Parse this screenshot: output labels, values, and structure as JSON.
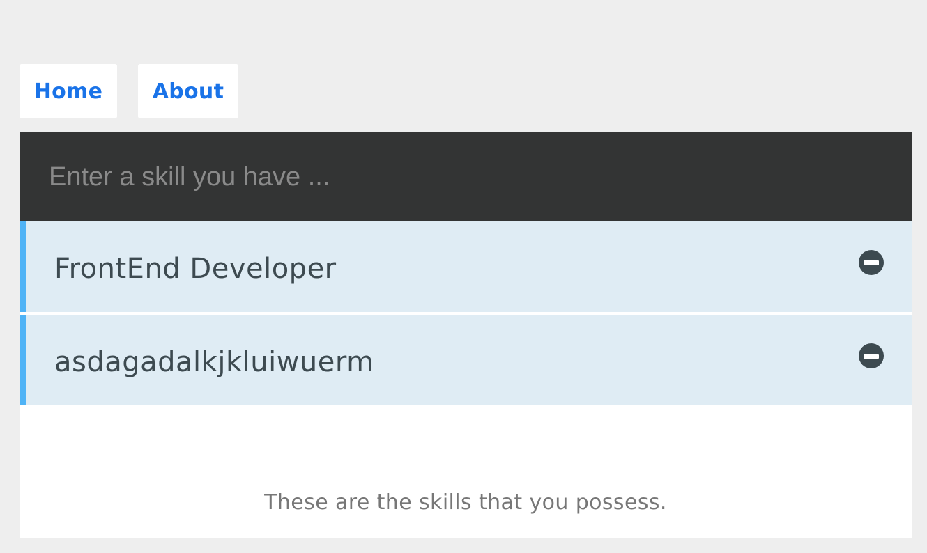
{
  "nav": {
    "home_label": "Home",
    "about_label": "About"
  },
  "skill_input": {
    "placeholder": "Enter a skill you have ...",
    "value": ""
  },
  "skills": [
    {
      "name": "FrontEnd Developer",
      "remove_icon": "minus-circle-icon"
    },
    {
      "name": "asdagadalkjkluiwuerm",
      "remove_icon": "minus-circle-icon"
    }
  ],
  "footer": {
    "text": "These are the skills that you possess."
  },
  "colors": {
    "page_background": "#eeeeee",
    "nav_link": "#1a73e8",
    "input_background": "#333434",
    "skill_item_background": "#dfecf4",
    "skill_item_accent": "#4fb3f6",
    "skill_text": "#3d4a50",
    "footer_text": "#777777"
  }
}
